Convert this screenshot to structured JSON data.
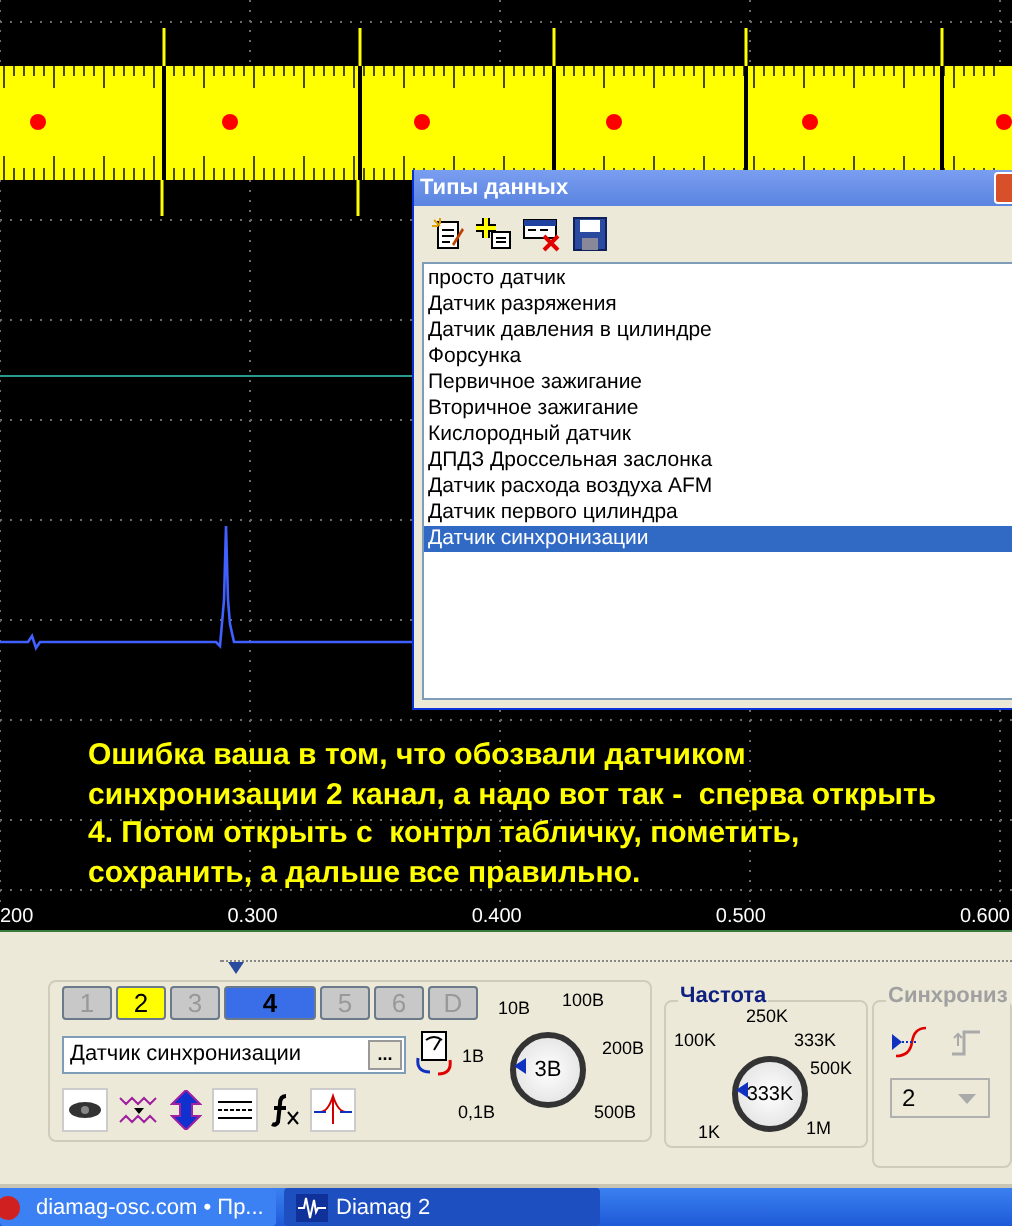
{
  "scope": {
    "annotation": "Ошибка ваша в том, что обозвали датчиком\nсинхронизации 2 канал, а надо вот так -  сперва открыть\n4. Потом открыть с  контрл табличку, пометить,\nсохранить, а дальше все правильно.",
    "time_axis": [
      "200",
      "0.300",
      "0.400",
      "0.500",
      "0.600"
    ]
  },
  "data_types_window": {
    "title": "Типы данных",
    "items": [
      {
        "label": "просто датчик",
        "selected": false
      },
      {
        "label": "Датчик разряжения",
        "selected": false
      },
      {
        "label": "Датчик давления в цилиндре",
        "selected": false
      },
      {
        "label": "Форсунка",
        "selected": false
      },
      {
        "label": "Первичное зажигание",
        "selected": false
      },
      {
        "label": "Вторичное зажигание",
        "selected": false
      },
      {
        "label": "Кислородный датчик",
        "selected": false
      },
      {
        "label": "ДПДЗ Дроссельная заслонка",
        "selected": false
      },
      {
        "label": "Датчик расхода воздуха AFM",
        "selected": false
      },
      {
        "label": "Датчик первого цилиндра",
        "selected": false
      },
      {
        "label": "Датчик синхронизации",
        "selected": true
      }
    ]
  },
  "channel_panel": {
    "tabs": [
      {
        "label": "1",
        "selected": false,
        "enabled": false,
        "color": "#c8c8c8"
      },
      {
        "label": "2",
        "selected": false,
        "enabled": true,
        "color": "#ffff00"
      },
      {
        "label": "3",
        "selected": false,
        "enabled": false,
        "color": "#c8c8c8"
      },
      {
        "label": "4",
        "selected": true,
        "enabled": true,
        "color": "#3a6ee8"
      },
      {
        "label": "5",
        "selected": false,
        "enabled": false,
        "color": "#c8c8c8"
      },
      {
        "label": "6",
        "selected": false,
        "enabled": false,
        "color": "#c8c8c8"
      },
      {
        "label": "D",
        "selected": false,
        "enabled": false,
        "color": "#c8c8c8"
      }
    ],
    "sensor_type": "Датчик синхронизации",
    "browse_button": "..."
  },
  "voltage_knob": {
    "scale": [
      "10В",
      "100В",
      "1В",
      "200В",
      "0,1В",
      "500В"
    ],
    "value": "3В"
  },
  "frequency": {
    "title": "Частота",
    "scale": [
      "250K",
      "100K",
      "333K",
      "500K",
      "1K",
      "1M"
    ],
    "value": "333K"
  },
  "sync": {
    "title": "Синхрониз",
    "channel": "2"
  },
  "taskbar": [
    {
      "label": "diamag-osc.com • Пр...",
      "selected": false
    },
    {
      "label": "Diamag 2",
      "selected": true
    }
  ]
}
